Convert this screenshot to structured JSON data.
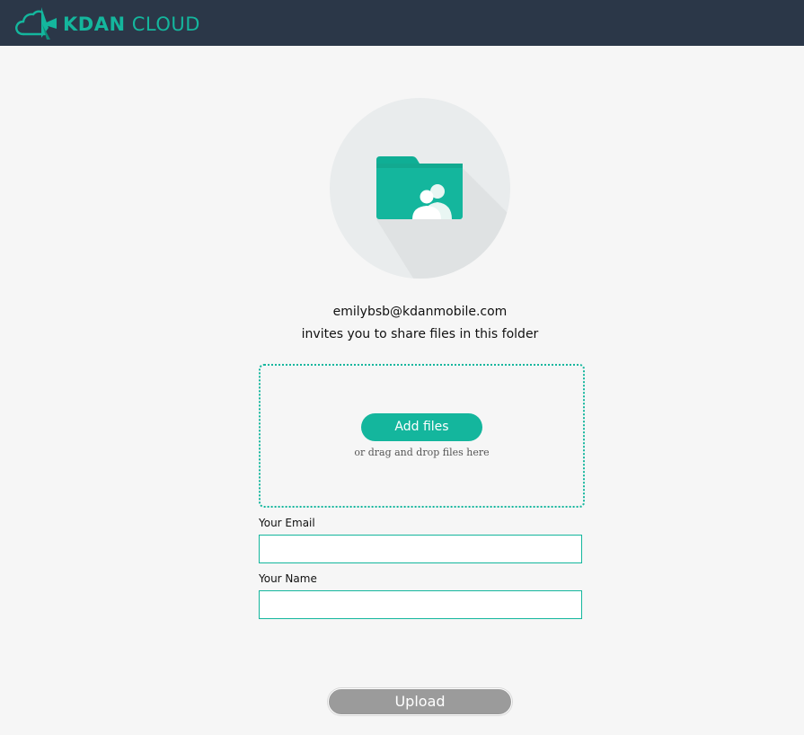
{
  "brand": {
    "name_bold": "KDAN",
    "name_light": "CLOUD",
    "accent_color": "#14b69d",
    "header_color": "#2b3748"
  },
  "icons": {
    "logo": "kdan-cloud-logo-icon",
    "hero": "shared-folder-icon"
  },
  "invite": {
    "sender_email": "emilybsb@kdanmobile.com",
    "message": "invites you to share files in this folder"
  },
  "dropzone": {
    "add_files_label": "Add files",
    "hint": "or drag and drop files here"
  },
  "form": {
    "email_label": "Your Email",
    "email_value": "",
    "name_label": "Your Name",
    "name_value": ""
  },
  "actions": {
    "upload_label": "Upload"
  }
}
